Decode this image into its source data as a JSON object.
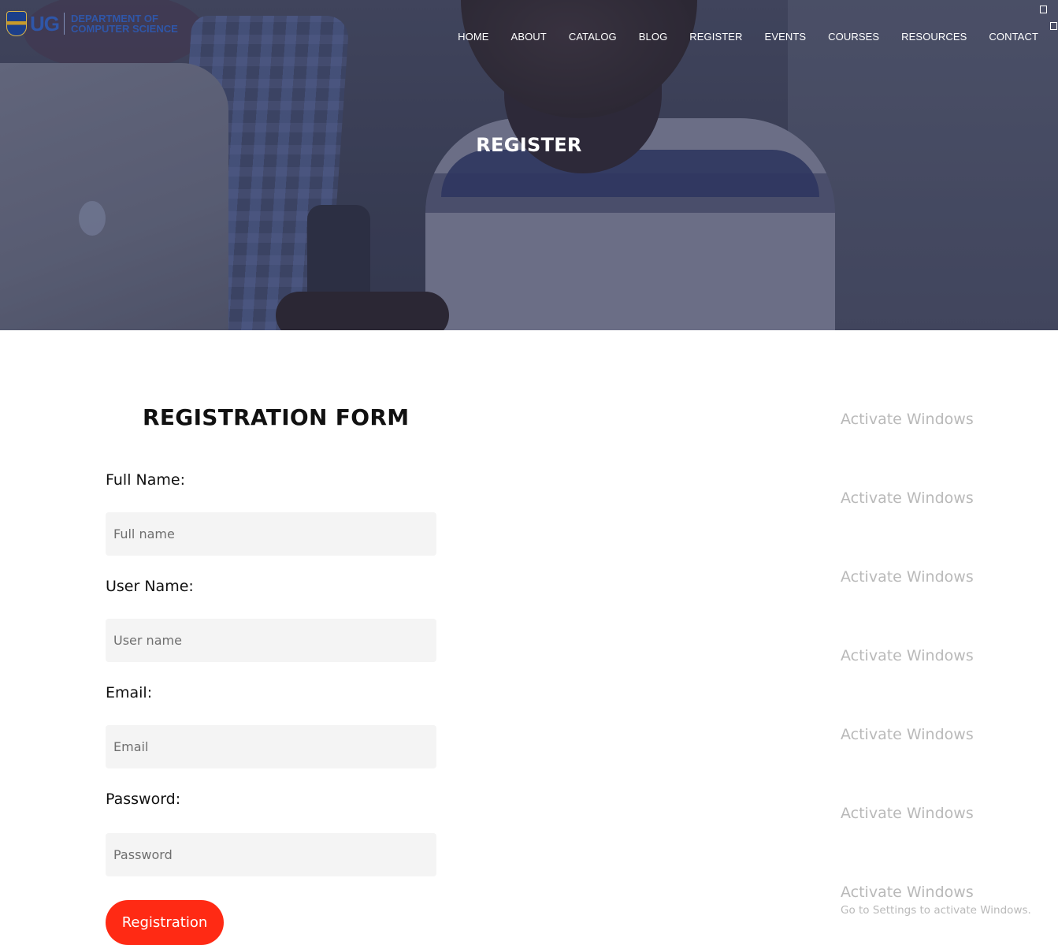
{
  "logo": {
    "abbr": "UG",
    "line1": "DEPARTMENT OF",
    "line2": "COMPUTER SCIENCE"
  },
  "nav": {
    "items": [
      "HOME",
      "ABOUT",
      "CATALOG",
      "BLOG",
      "REGISTER",
      "EVENTS",
      "COURSES",
      "RESOURCES",
      "CONTACT"
    ]
  },
  "hero": {
    "title": "REGISTER"
  },
  "form": {
    "title": "REGISTRATION FORM",
    "fields": [
      {
        "label": "Full Name:",
        "placeholder": "Full name",
        "value": ""
      },
      {
        "label": "User Name:",
        "placeholder": "User name",
        "value": ""
      },
      {
        "label": "Email:",
        "placeholder": "Email",
        "value": ""
      },
      {
        "label": "Password:",
        "placeholder": "Password",
        "value": ""
      }
    ],
    "submit_label": "Registration"
  },
  "watermark": {
    "lines": [
      "Activate Windows",
      "Activate Windows",
      "Activate Windows",
      "Activate Windows",
      "Activate Windows",
      "Activate Windows",
      "Activate Windows"
    ],
    "sub": "Go to Settings to activate Windows."
  },
  "colors": {
    "accent": "#ff2a14",
    "input_bg": "#f4f4f4",
    "nav_text": "#ffffff",
    "logo_blue": "#2f56a8"
  }
}
